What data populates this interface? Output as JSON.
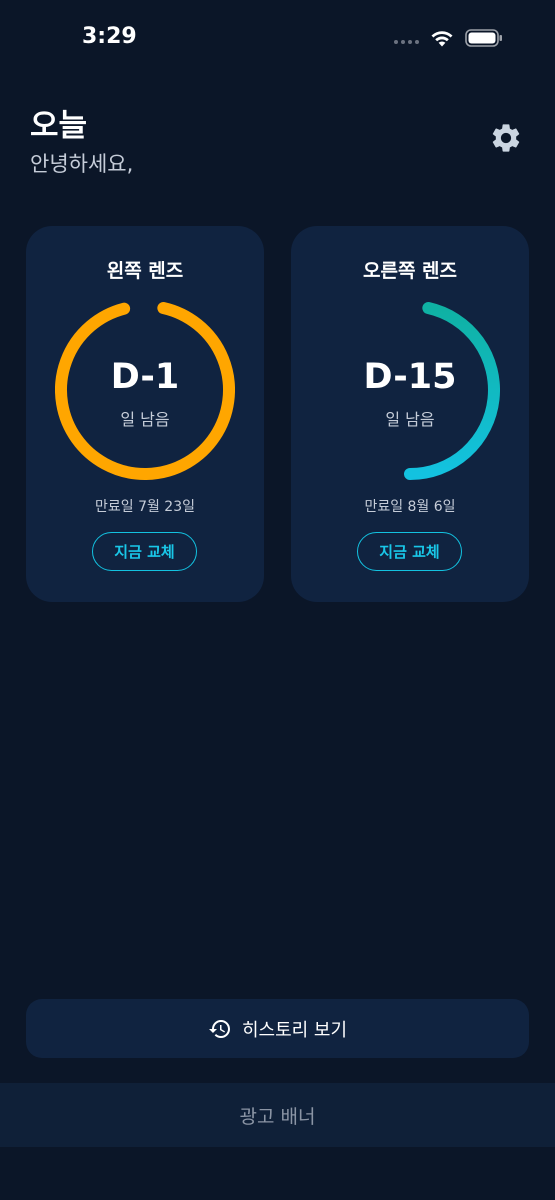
{
  "status_bar": {
    "time": "3:29"
  },
  "header": {
    "title": "오늘",
    "subtitle": "안녕하세요,"
  },
  "cards": [
    {
      "title": "왼쪽 렌즈",
      "dday": "D-1",
      "days_left_label": "일 남음",
      "expiry": "만료일 7월 23일",
      "button_label": "지금 교체",
      "progress_fraction": 0.96,
      "ring_color_start": "#ffa600",
      "ring_color_end": "#ffa600"
    },
    {
      "title": "오른쪽 렌즈",
      "dday": "D-15",
      "days_left_label": "일 남음",
      "expiry": "만료일 8월 6일",
      "button_label": "지금 교체",
      "progress_fraction": 0.5,
      "ring_color_start": "#0fb1a3",
      "ring_color_end": "#13c2e0"
    }
  ],
  "history": {
    "label": "히스토리 보기",
    "icon": "history-icon"
  },
  "ad": {
    "label": "광고 배너"
  },
  "colors": {
    "background": "#0b1628",
    "card": "#102340",
    "accent": "#13c2e0",
    "orange": "#ffa600"
  }
}
